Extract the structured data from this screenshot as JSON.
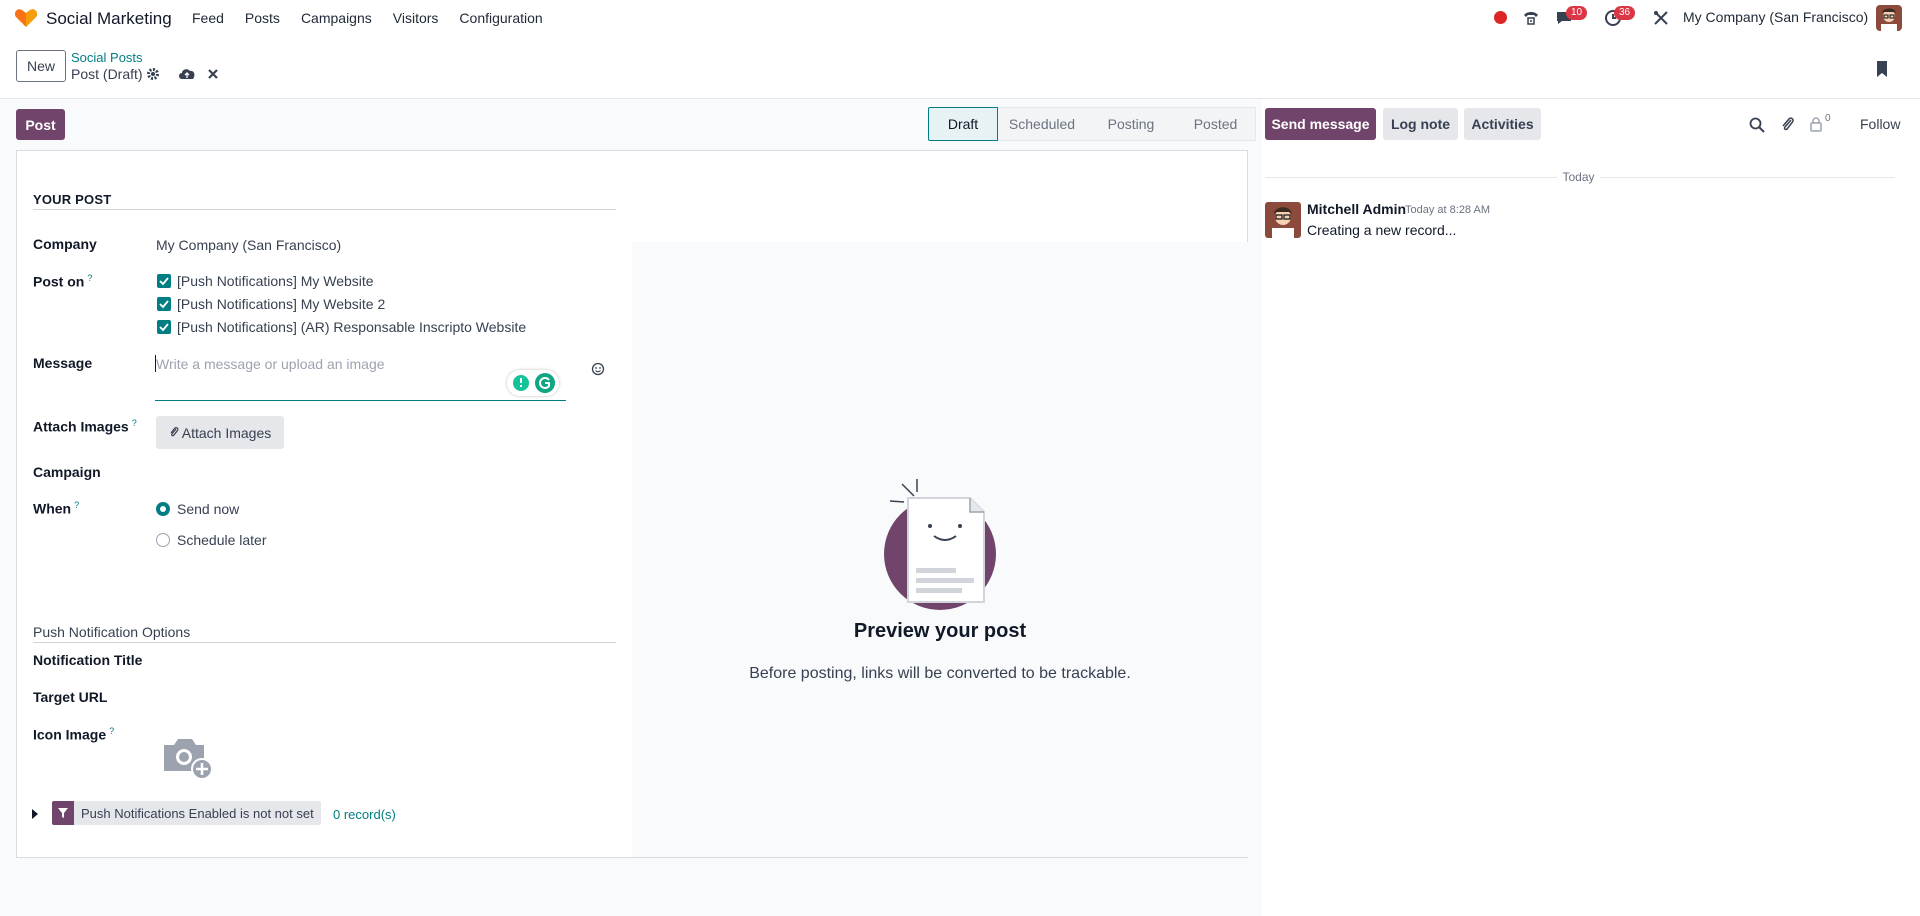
{
  "navbar": {
    "app_name": "Social Marketing",
    "menu": [
      "Feed",
      "Posts",
      "Campaigns",
      "Visitors",
      "Configuration"
    ],
    "messages_count": "10",
    "activities_count": "36",
    "company": "My Company (San Francisco)"
  },
  "control_panel": {
    "new_label": "New",
    "breadcrumb_parent": "Social Posts",
    "breadcrumb_current": "Post (Draft)"
  },
  "status": {
    "post_label": "Post",
    "stages": [
      "Draft",
      "Scheduled",
      "Posting",
      "Posted"
    ],
    "active_stage": "Draft"
  },
  "form": {
    "section_title": "YOUR POST",
    "company_label": "Company",
    "company_value": "My Company (San Francisco)",
    "post_on_label": "Post on",
    "post_on_help": "?",
    "accounts": [
      "[Push Notifications] My Website",
      "[Push Notifications] My Website 2",
      "[Push Notifications] (AR) Responsable Inscripto Website"
    ],
    "message_label": "Message",
    "message_placeholder": "Write a message or upload an image",
    "attach_label": "Attach Images",
    "attach_help": "?",
    "attach_button": "Attach Images",
    "campaign_label": "Campaign",
    "when_label": "When",
    "when_help": "?",
    "when_options": [
      "Send now",
      "Schedule later"
    ],
    "when_selected": "Send now",
    "push_section": "Push Notification Options",
    "notif_title_label": "Notification Title",
    "target_url_label": "Target URL",
    "icon_image_label": "Icon Image",
    "icon_image_help": "?",
    "filter_text": "Push Notifications Enabled is not not set",
    "records_text": "0 record(s)"
  },
  "preview": {
    "title": "Preview your post",
    "subtitle": "Before posting, links will be converted to be trackable."
  },
  "chatter": {
    "send_message": "Send message",
    "log_note": "Log note",
    "activities": "Activities",
    "followers_count": "0",
    "follow": "Follow",
    "date_separator": "Today",
    "message": {
      "author": "Mitchell Admin",
      "date": "Today at 8:28 AM",
      "body": "Creating a new record..."
    }
  },
  "colors": {
    "primary": "#71456b",
    "accent": "#017e84",
    "badge": "#dc3545"
  }
}
